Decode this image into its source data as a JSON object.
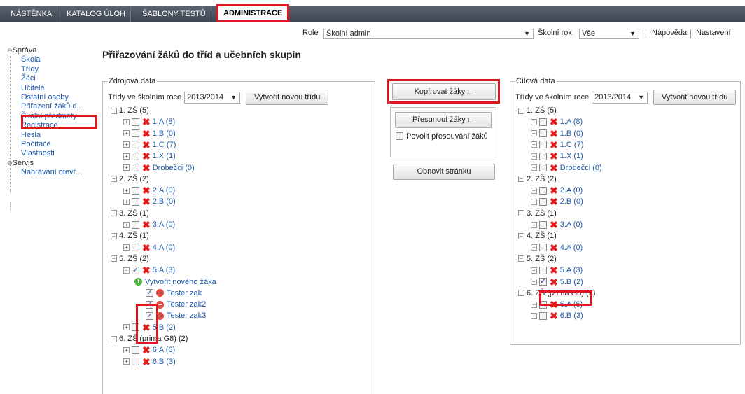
{
  "tabs": [
    {
      "label": "NÁSTĚNKA"
    },
    {
      "label": "KATALOG ÚLOH"
    },
    {
      "label": "ŠABLONY TESTŮ"
    },
    {
      "label": "ADMINISTRACE"
    }
  ],
  "rolebar": {
    "role_label": "Role",
    "role_value": "Školní admin",
    "year_label": "Školní rok",
    "year_value": "Vše",
    "help": "Nápověda",
    "settings": "Nastavení"
  },
  "nav": {
    "sprava": "Správa",
    "items": [
      "Škola",
      "Třídy",
      "Žáci",
      "Učitelé",
      "Ostatní osoby",
      "Přiřazení žáků d...",
      "Školní předměty",
      "Registrace",
      "Hesla",
      "Počítače",
      "Vlastnosti"
    ],
    "servis": "Servis",
    "servis_items": [
      "Nahrávání otevř..."
    ]
  },
  "page_title": "Přiřazování žáků do tříd a učebních skupin",
  "source": {
    "legend": "Zdrojová data",
    "year_label": "Třídy ve školním roce",
    "year_value": "2013/2014",
    "new_class": "Vytvořit novou třídu",
    "grades": [
      {
        "label": "1. ZŠ (5)",
        "classes": [
          "1.A (8)",
          "1.B (0)",
          "1.C (7)",
          "1.X (1)",
          "Drobečci (0)"
        ]
      },
      {
        "label": "2. ZŠ (2)",
        "classes": [
          "2.A (0)",
          "2.B (0)"
        ]
      },
      {
        "label": "3. ZŠ (1)",
        "classes": [
          "3.A (0)"
        ]
      },
      {
        "label": "4. ZŠ (1)",
        "classes": [
          "4.A (0)"
        ]
      },
      {
        "label": "5. ZŠ (2)",
        "classes": [
          "5.A (3)"
        ]
      },
      {
        "label": "6. ZŠ (prima G8) (2)",
        "classes": [
          "6.A (6)",
          "6.B (3)"
        ]
      }
    ],
    "create_student": "Vytvořit nového žáka",
    "students": [
      "Tester zak",
      "Tester zak2",
      "Tester zak3"
    ],
    "class_5b": "5.B (2)"
  },
  "actions": {
    "copy": "Kopírovat žáky ⟝",
    "move": "Přesunout žáky ⟝",
    "allow_move": "Povolit přesouvání žáků",
    "refresh": "Obnovit stránku"
  },
  "target": {
    "legend": "Cílová data",
    "year_label": "Třídy ve školním roce",
    "year_value": "2013/2014",
    "new_class": "Vytvořit novou třídu",
    "grades": [
      {
        "label": "1. ZŠ (5)",
        "classes": [
          "1.A (8)",
          "1.B (0)",
          "1.C (7)",
          "1.X (1)",
          "Drobečci (0)"
        ]
      },
      {
        "label": "2. ZŠ (2)",
        "classes": [
          "2.A (0)",
          "2.B (0)"
        ]
      },
      {
        "label": "3. ZŠ (1)",
        "classes": [
          "3.A (0)"
        ]
      },
      {
        "label": "4. ZŠ (1)",
        "classes": [
          "4.A (0)"
        ]
      },
      {
        "label": "5. ZŠ (2)",
        "classes": [
          "5.A (3)",
          "5.B (2)"
        ]
      },
      {
        "label": "6. ZŠ (prima G8) (2)",
        "classes": [
          "6.A (6)",
          "6.B (3)"
        ]
      }
    ]
  }
}
